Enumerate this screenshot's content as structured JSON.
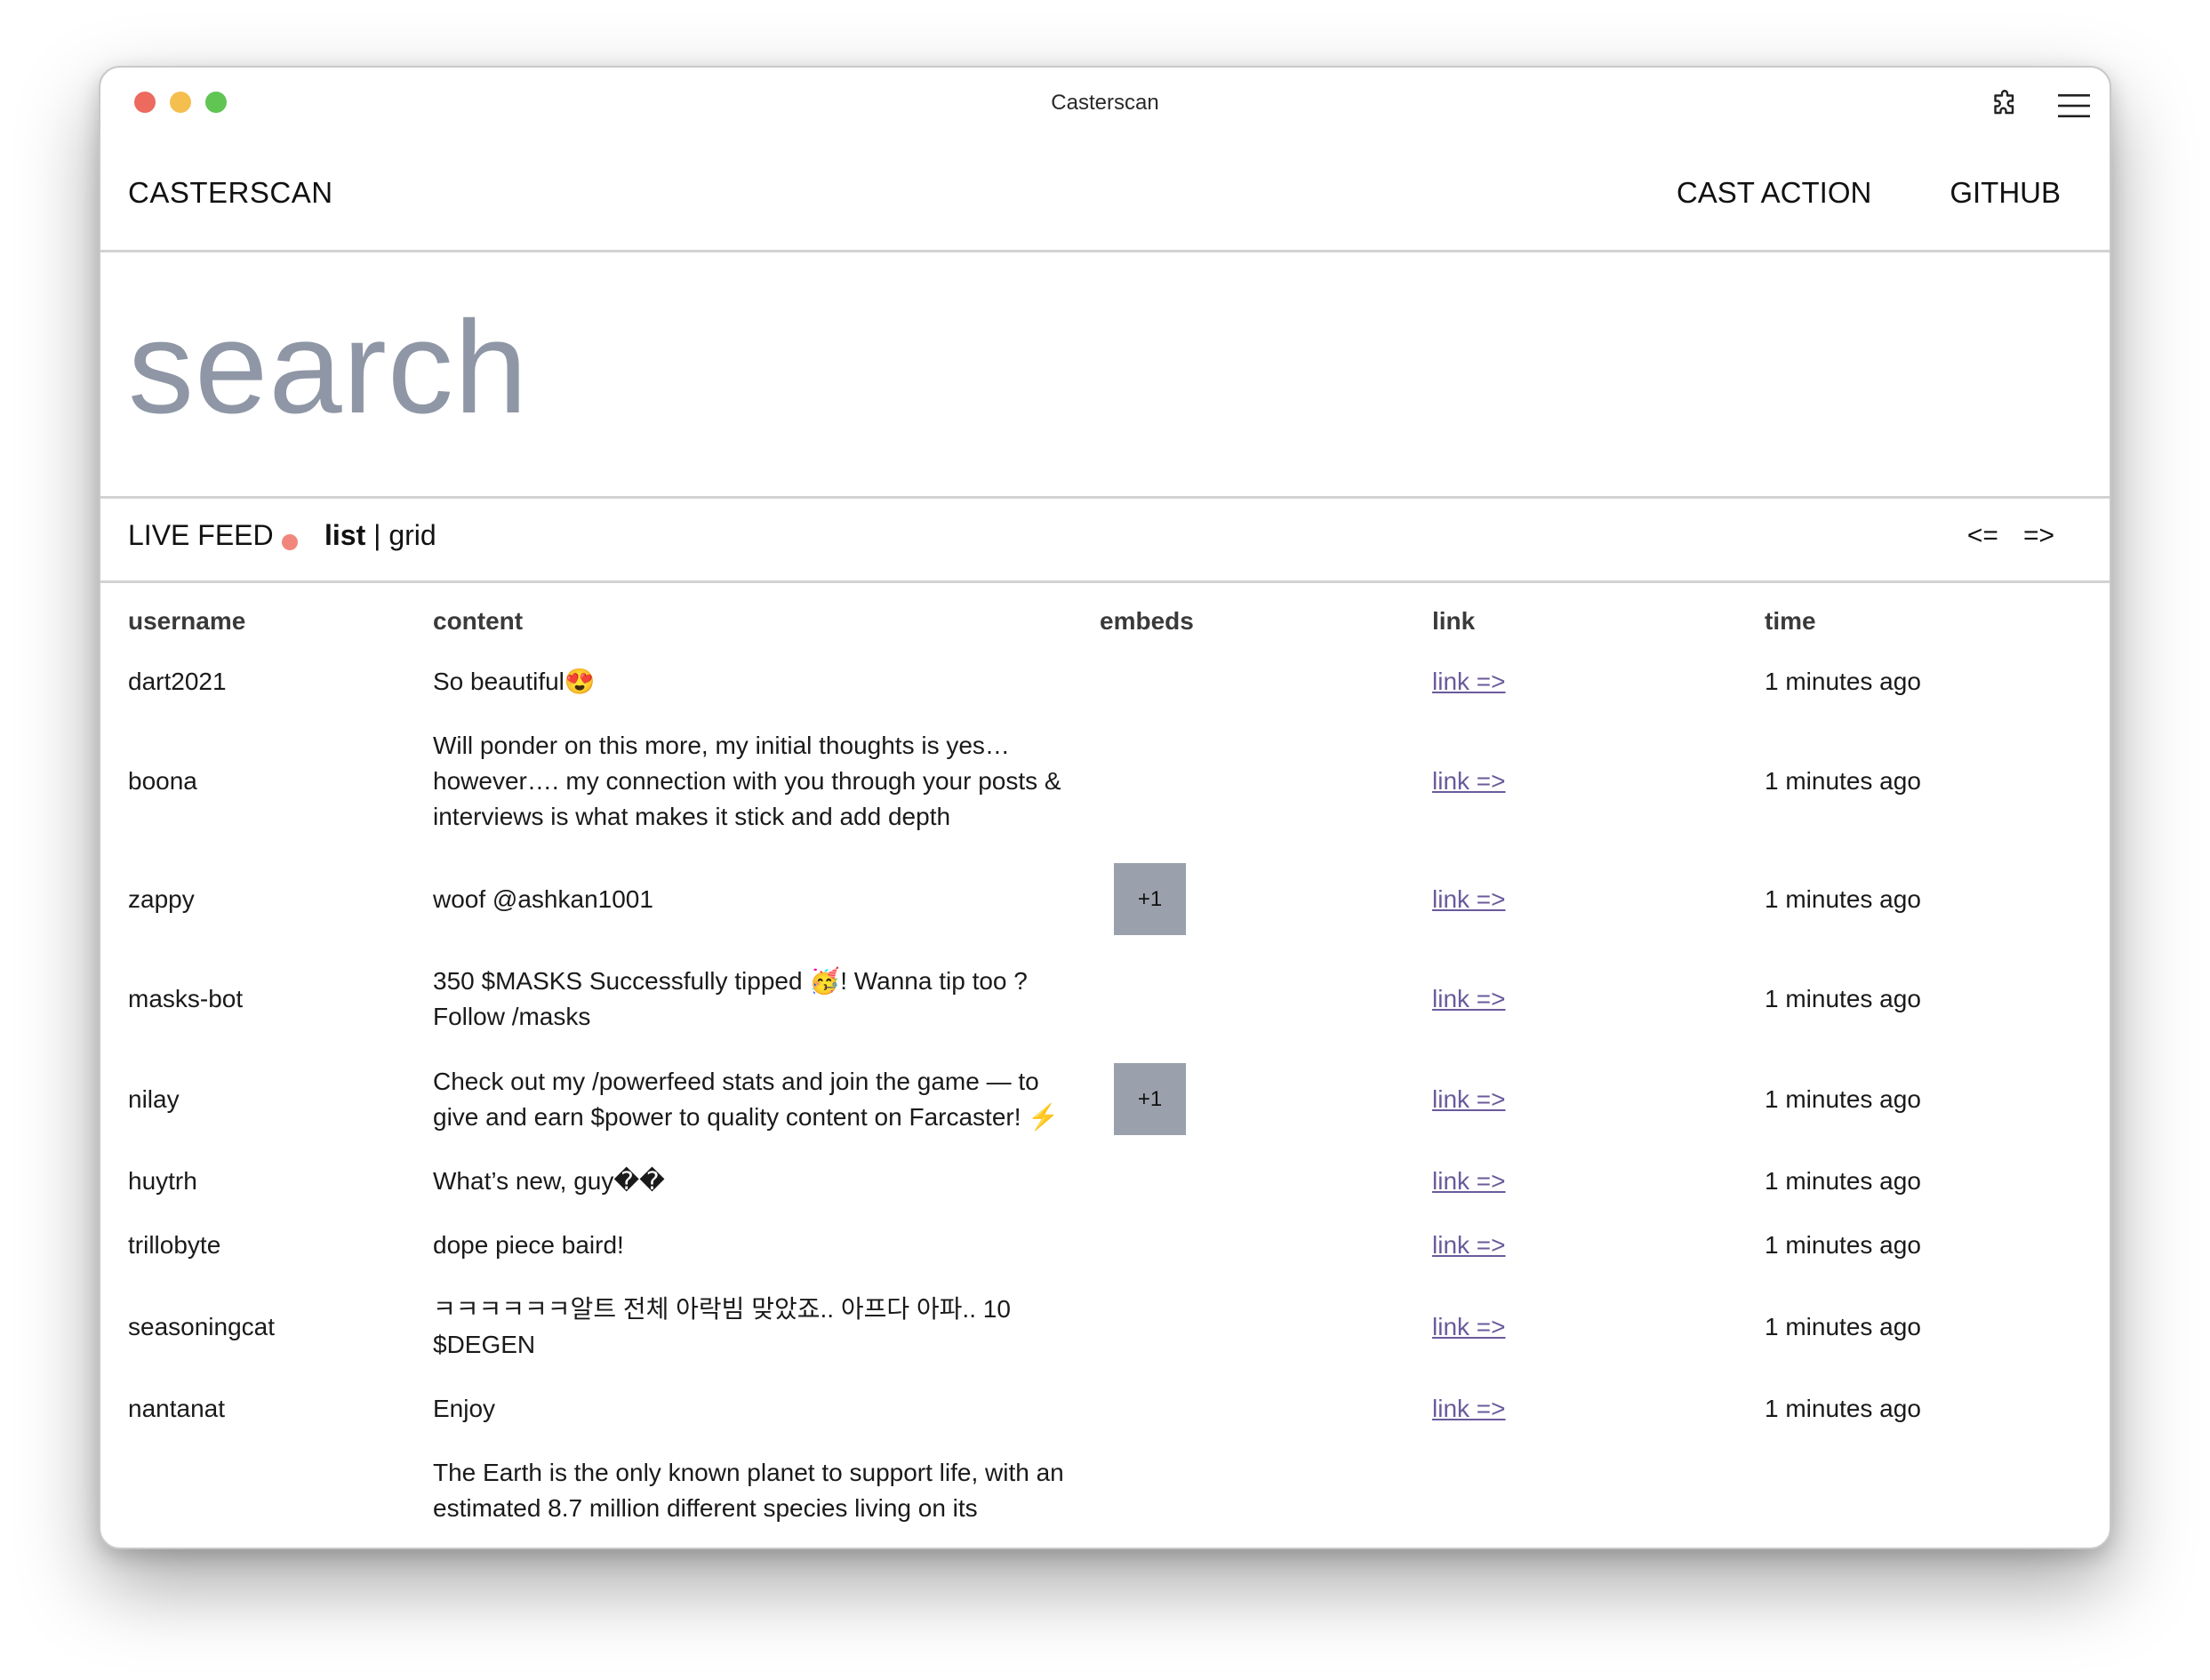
{
  "window": {
    "title": "Casterscan"
  },
  "nav": {
    "brand": "CASTERSCAN",
    "cast_action": "CAST ACTION",
    "github": "GITHUB"
  },
  "search": {
    "placeholder": "search"
  },
  "feedbar": {
    "live_label": "LIVE FEED",
    "list_label": "list",
    "separator": " | ",
    "grid_label": "grid",
    "prev": "<=",
    "next": "=>"
  },
  "table": {
    "headers": {
      "username": "username",
      "content": "content",
      "embeds": "embeds",
      "link": "link",
      "time": "time"
    },
    "rows": [
      {
        "username": "dart2021",
        "content": "So beautiful😍",
        "embeds": "",
        "link": "link =>",
        "time": "1 minutes ago"
      },
      {
        "username": "boona",
        "content": "Will ponder on this more, my initial thoughts is yes… however…. my connection with you through your posts & interviews is what makes it stick and add depth",
        "embeds": "",
        "link": "link =>",
        "time": "1 minutes ago"
      },
      {
        "username": "zappy",
        "content": "woof @ashkan1001",
        "embeds": "+1",
        "link": "link =>",
        "time": "1 minutes ago"
      },
      {
        "username": "masks-bot",
        "content": "350 $MASKS Successfully tipped 🥳! Wanna tip too ? Follow /masks",
        "embeds": "",
        "link": "link =>",
        "time": "1 minutes ago"
      },
      {
        "username": "nilay",
        "content": "Check out my /powerfeed stats and join the game — to give and earn $power to quality content on Farcaster! ⚡",
        "embeds": "+1",
        "link": "link =>",
        "time": "1 minutes ago"
      },
      {
        "username": "huytrh",
        "content": "What’s new, guy��",
        "embeds": "",
        "link": "link =>",
        "time": "1 minutes ago"
      },
      {
        "username": "trillobyte",
        "content": "dope piece baird!",
        "embeds": "",
        "link": "link =>",
        "time": "1 minutes ago"
      },
      {
        "username": "seasoningcat",
        "content": "ㅋㅋㅋㅋㅋㅋ알트 전체 아락빔 맞았죠.. 아프다 아파.. 10 $DEGEN",
        "embeds": "",
        "link": "link =>",
        "time": "1 minutes ago"
      },
      {
        "username": "nantanat",
        "content": "Enjoy",
        "embeds": "",
        "link": "link =>",
        "time": "1 minutes ago"
      },
      {
        "username": "",
        "content": "The Earth is the only known planet to support life, with an estimated 8.7 million different species living on its",
        "embeds": "",
        "link": "",
        "time": ""
      }
    ]
  }
}
